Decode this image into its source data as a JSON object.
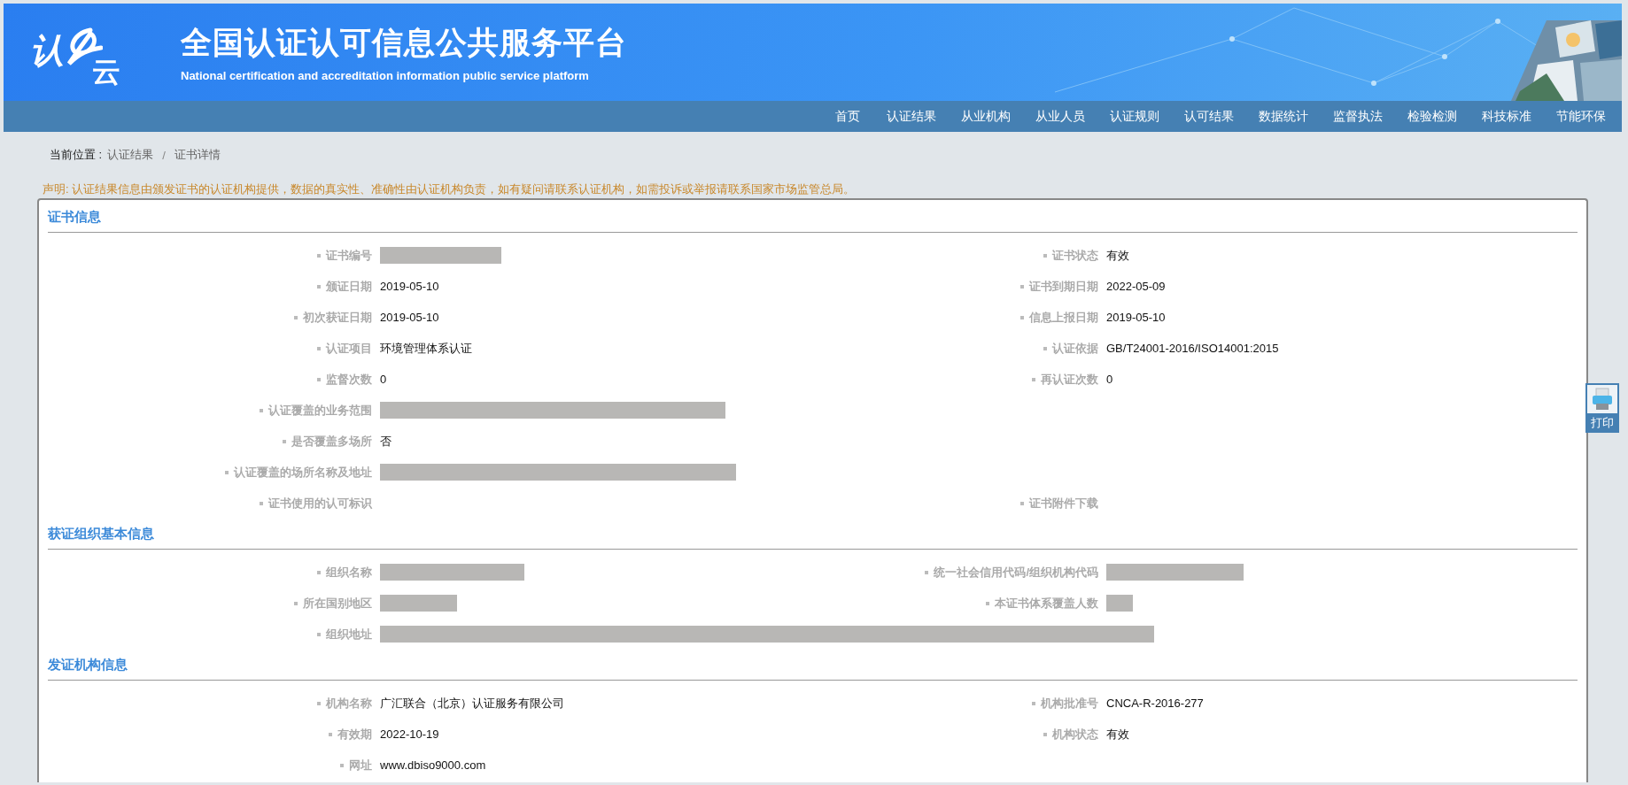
{
  "header": {
    "logo_left": "认",
    "logo_right": "云",
    "title": "全国认证认可信息公共服务平台",
    "subtitle": "National certification and accreditation information public service platform"
  },
  "nav": [
    "首页",
    "认证结果",
    "从业机构",
    "从业人员",
    "认证规则",
    "认可结果",
    "数据统计",
    "监督执法",
    "检验检测",
    "科技标准",
    "节能环保"
  ],
  "breadcrumb": {
    "label": "当前位置 :",
    "items": [
      "认证结果",
      "证书详情"
    ],
    "separator": "/"
  },
  "notice": "声明: 认证结果信息由颁发证书的认证机构提供，数据的真实性、准确性由认证机构负责，如有疑问请联系认证机构，如需投诉或举报请联系国家市场监管总局。",
  "sections": [
    {
      "title": "证书信息",
      "rows": [
        [
          {
            "label": "证书编号",
            "kind": "redacted"
          },
          {
            "label": "证书状态",
            "kind": "text",
            "value": "有效"
          }
        ],
        [
          {
            "label": "颁证日期",
            "kind": "text",
            "value": "2019-05-10"
          },
          {
            "label": "证书到期日期",
            "kind": "text",
            "value": "2022-05-09"
          }
        ],
        [
          {
            "label": "初次获证日期",
            "kind": "text",
            "value": "2019-05-10"
          },
          {
            "label": "信息上报日期",
            "kind": "text",
            "value": "2019-05-10"
          }
        ],
        [
          {
            "label": "认证项目",
            "kind": "text",
            "value": "环境管理体系认证"
          },
          {
            "label": "认证依据",
            "kind": "text",
            "value": "GB/T24001-2016/ISO14001:2015"
          }
        ],
        [
          {
            "label": "监督次数",
            "kind": "text",
            "value": "0"
          },
          {
            "label": "再认证次数",
            "kind": "text",
            "value": "0"
          }
        ],
        [
          {
            "label": "认证覆盖的业务范围",
            "kind": "redacted"
          }
        ],
        [
          {
            "label": "是否覆盖多场所",
            "kind": "text",
            "value": "否"
          }
        ],
        [
          {
            "label": "认证覆盖的场所名称及地址",
            "kind": "redacted"
          }
        ],
        [
          {
            "label": "证书使用的认可标识",
            "kind": "blank"
          },
          {
            "label": "证书附件下载",
            "kind": "blank"
          }
        ]
      ]
    },
    {
      "title": "获证组织基本信息",
      "rows": [
        [
          {
            "label": "组织名称",
            "kind": "redacted"
          },
          {
            "label": "统一社会信用代码/组织机构代码",
            "kind": "redacted"
          }
        ],
        [
          {
            "label": "所在国别地区",
            "kind": "redacted"
          },
          {
            "label": "本证书体系覆盖人数",
            "kind": "redacted"
          }
        ],
        [
          {
            "label": "组织地址",
            "kind": "redacted"
          }
        ]
      ]
    },
    {
      "title": "发证机构信息",
      "rows": [
        [
          {
            "label": "机构名称",
            "kind": "text",
            "value": "广汇联合（北京）认证服务有限公司"
          },
          {
            "label": "机构批准号",
            "kind": "text",
            "value": "CNCA-R-2016-277"
          }
        ],
        [
          {
            "label": "有效期",
            "kind": "text",
            "value": "2022-10-19"
          },
          {
            "label": "机构状态",
            "kind": "text",
            "value": "有效"
          }
        ],
        [
          {
            "label": "网址",
            "kind": "text",
            "value": "www.dbiso9000.com"
          }
        ]
      ]
    }
  ],
  "print_button": {
    "label": "打印"
  }
}
